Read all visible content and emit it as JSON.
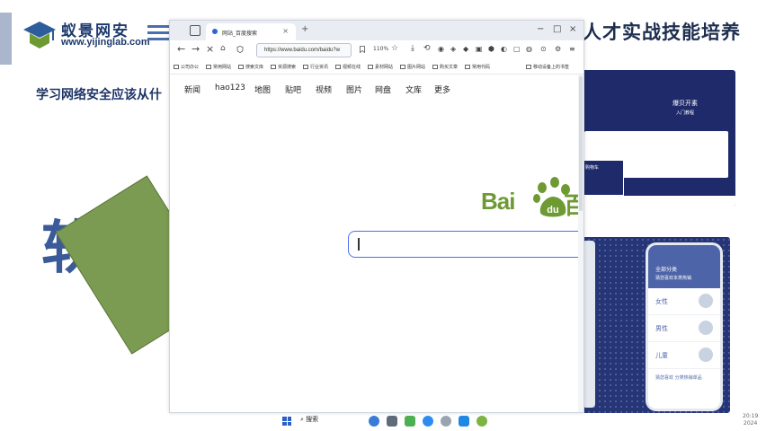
{
  "slide": {
    "logo_name": "蚁景网安",
    "logo_url": "www.yijinglab.com",
    "title_right": "人才实战技能培养",
    "subtitle": "学习网络安全应该从什",
    "big_word": "软件",
    "date_text": [
      "20:19",
      "2024"
    ],
    "thumb_top": {
      "banner_text": "爆贝开素",
      "banner_sub": "入门教程",
      "tag": "购物车",
      "cells": [
        "模块",
        "模块",
        "模块"
      ]
    },
    "thumb_bottom": {
      "header": "全部分类",
      "header_sub": "猜您喜欢本类热销",
      "rows": [
        "女性",
        "男性",
        "儿童"
      ],
      "footer": "猜您喜欢 分类热销单品"
    }
  },
  "browser": {
    "tab_title": "网站_百度搜索",
    "url": "https://www.baidu.com/baidu?w",
    "zoom": "110%",
    "bookmarks": [
      "公司办公",
      "常用网站",
      "搜索文库",
      "资源搜索",
      "行业资讯",
      "视频在线",
      "素材网站",
      "图片网站",
      "购买文章",
      "常用代码",
      "移动设备上的书签"
    ],
    "nav_links": [
      "新闻",
      "hao123",
      "地图",
      "贴吧",
      "视频",
      "图片",
      "网盘",
      "文库",
      "更多"
    ],
    "baidu_logo_text": "Bai",
    "baidu_logo_du": "du",
    "baidu_logo_tail": "百"
  },
  "taskbar": {
    "search_label": "搜索"
  },
  "colors": {
    "navy": "#1f2a6b",
    "baidu_green": "#6e9a33",
    "slide_green": "#7b9a52",
    "search_border": "#4e6ef2"
  }
}
